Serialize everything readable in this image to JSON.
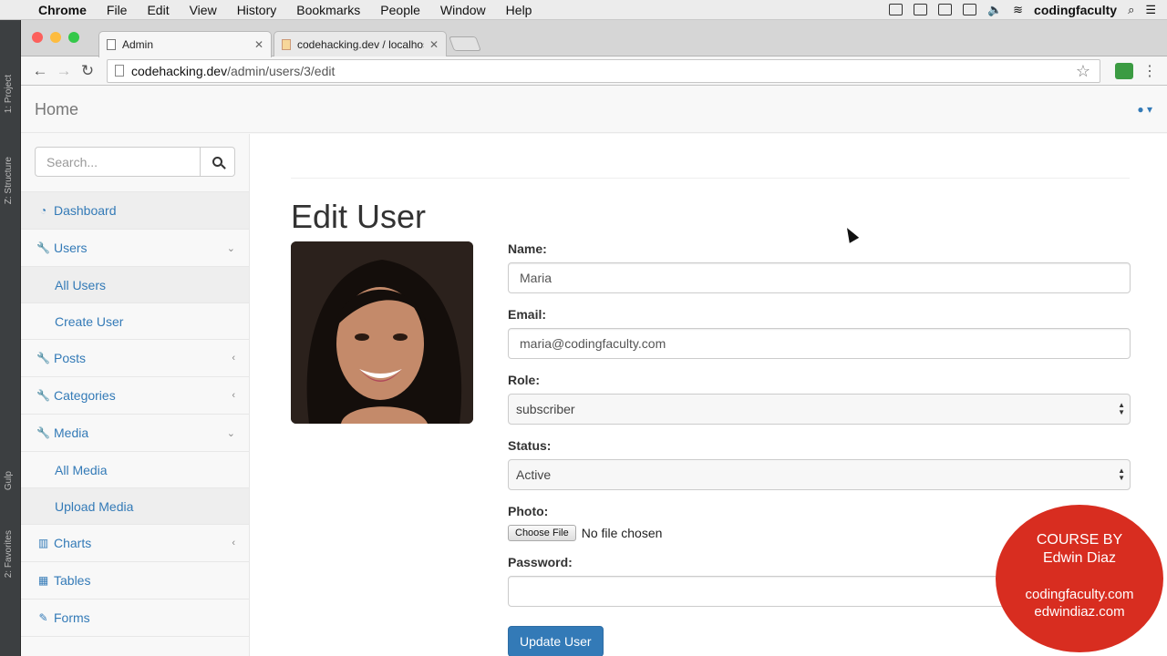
{
  "menubar": {
    "app_name": "Chrome",
    "items": [
      "File",
      "Edit",
      "View",
      "History",
      "Bookmarks",
      "People",
      "Window",
      "Help"
    ],
    "user": "codingfaculty"
  },
  "ide": {
    "project_label": "1: Project",
    "structure_label": "Z: Structure",
    "gulp_label": "Gulp",
    "favorites_label": "2: Favorites"
  },
  "tabs": [
    {
      "title": "Admin"
    },
    {
      "title": "codehacking.dev / localhost"
    }
  ],
  "address": {
    "host": "codehacking.dev",
    "path": "/admin/users/3/edit"
  },
  "topnav": {
    "brand": "Home"
  },
  "search": {
    "placeholder": "Search..."
  },
  "sidebar": {
    "items": [
      {
        "label": "Dashboard",
        "icon": "dashboard-icon"
      },
      {
        "label": "Users",
        "icon": "wrench-icon",
        "arrow": "expanded"
      },
      {
        "label": "All Users",
        "sub": true
      },
      {
        "label": "Create User",
        "sub": true
      },
      {
        "label": "Posts",
        "icon": "wrench-icon",
        "arrow": "collapsed"
      },
      {
        "label": "Categories",
        "icon": "wrench-icon",
        "arrow": "collapsed"
      },
      {
        "label": "Media",
        "icon": "wrench-icon",
        "arrow": "expanded"
      },
      {
        "label": "All Media",
        "sub": true
      },
      {
        "label": "Upload Media",
        "sub": true
      },
      {
        "label": "Charts",
        "icon": "bar-chart-icon",
        "arrow": "collapsed"
      },
      {
        "label": "Tables",
        "icon": "table-icon"
      },
      {
        "label": "Forms",
        "icon": "edit-icon"
      }
    ]
  },
  "main": {
    "title": "Edit User",
    "form": {
      "name_label": "Name:",
      "name_value": "Maria",
      "email_label": "Email:",
      "email_value": "maria@codingfaculty.com",
      "role_label": "Role:",
      "role_value": "subscriber",
      "status_label": "Status:",
      "status_value": "Active",
      "photo_label": "Photo:",
      "choose_file": "Choose File",
      "no_file": "No file chosen",
      "password_label": "Password:",
      "password_value": "",
      "submit_label": "Update User"
    }
  },
  "watermark": {
    "line1": "COURSE BY",
    "line2": "Edwin Diaz",
    "line3": "codingfaculty.com",
    "line4": "edwindiaz.com"
  },
  "colors": {
    "link": "#337ab7",
    "primary_button": "#337ab7",
    "badge": "#d82d20"
  }
}
